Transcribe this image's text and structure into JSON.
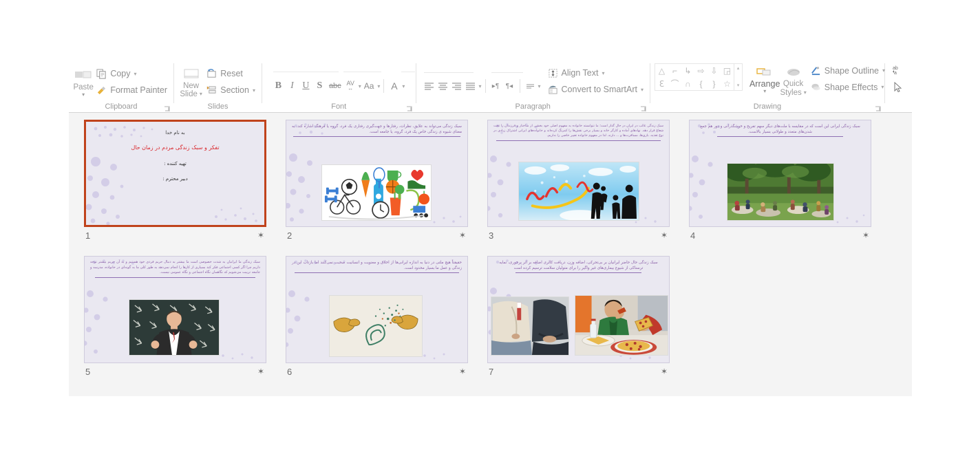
{
  "app": {
    "name": "PowerPoint Slide Sorter"
  },
  "ribbon": {
    "groups": [
      {
        "id": "clipboard",
        "label": "Clipboard",
        "paste_label": "Paste",
        "commands": [
          {
            "icon": "copy-icon",
            "label": "Copy",
            "has_arrow": true
          },
          {
            "icon": "format-painter-icon",
            "label": "Format Painter",
            "has_arrow": false
          }
        ]
      },
      {
        "id": "slides",
        "label": "Slides",
        "new_slide_label": "New\nSlide",
        "new_slide_line1": "New",
        "new_slide_line2": "Slide",
        "commands": [
          {
            "icon": "reset-icon",
            "label": "Reset",
            "has_arrow": false
          },
          {
            "icon": "section-icon",
            "label": "Section",
            "has_arrow": true
          }
        ]
      },
      {
        "id": "font",
        "label": "Font",
        "buttons": [
          {
            "icon": "bold-icon",
            "label": "B"
          },
          {
            "icon": "italic-icon",
            "label": "I"
          },
          {
            "icon": "underline-icon",
            "label": "U"
          },
          {
            "icon": "text-shadow-icon",
            "label": "S"
          },
          {
            "icon": "strikethrough-icon",
            "label": "abc"
          },
          {
            "icon": "character-spacing-icon",
            "label": "AV"
          },
          {
            "icon": "change-case-icon",
            "label": "Aa"
          },
          {
            "icon": "font-color-icon",
            "label": "A"
          }
        ]
      },
      {
        "id": "paragraph",
        "label": "Paragraph",
        "commands": [
          {
            "icon": "align-text-icon",
            "label": "Align Text",
            "has_arrow": true
          },
          {
            "icon": "convert-to-smartart-icon",
            "label": "Convert to SmartArt",
            "has_arrow": true
          }
        ]
      },
      {
        "id": "drawing",
        "label": "Drawing",
        "arrange_label": "Arrange",
        "quick_styles_line1": "Quick",
        "quick_styles_line2": "Styles",
        "commands": [
          {
            "icon": "shape-outline-icon",
            "label": "Shape Outline",
            "has_arrow": true
          },
          {
            "icon": "shape-effects-icon",
            "label": "Shape Effects",
            "has_arrow": true
          }
        ]
      },
      {
        "id": "editing",
        "label": "",
        "commands": [
          {
            "icon": "replace-icon",
            "label": ""
          },
          {
            "icon": "select-pointer-icon",
            "label": ""
          }
        ]
      }
    ]
  },
  "slides": [
    {
      "number": "1",
      "selected": true,
      "has_transition_star": true,
      "layout": "title",
      "lines": [
        "به نام خدا",
        "تفکر و سبک زندگی مردم در زمان حال",
        "تهیه کننده :",
        "دبیر محترم :"
      ],
      "title_color": "#d9262b"
    },
    {
      "number": "2",
      "selected": false,
      "has_transition_star": true,
      "layout": "text-image",
      "body": "سبک زندگی می‌تواند به علایق، نظرات، رفتارها و جهت‌گیری رفتاری یک فرد، گروه یا فرهنگ اشاره کند. به معنای شیوه ی زندگی خاص یک فرد، گروه، یا جامعه است.",
      "image_name": "healthy-lifestyle-illustration"
    },
    {
      "number": "3",
      "selected": false,
      "has_transition_star": true,
      "layout": "text-image",
      "body": "سبک زندگی غالب در ایران در حال گذار است؛ ما نتوانسته خانواده به مفهوم اصلی خود بخشی از ساختار و فرزندان را تحت شعاع قرار دهد. نهادهای آماده و کارگر خانه و بسیار برخی نقش‌ها را کمرنگ کرده‌اند و خانواده‌های ایرانی اشتراک زیادی در نوع تغذیه، بازی‌ها، مسافرت‌ها و ... دارند. لذا در مفهوم خانواده تغییر خاصی را نداریم.",
      "image_name": "sabk-zendegi-banner"
    },
    {
      "number": "4",
      "selected": false,
      "has_transition_star": true,
      "layout": "text-image",
      "body": "سبک زندگی ایرانی این است که در مقایسه با ملت‌های دیگر سهم تفریح و خوشگذرانی و دور هم جمع شدن‌های متعدد و طولانی بسیار بالاست.",
      "image_name": "park-picnic-photo"
    },
    {
      "number": "5",
      "selected": false,
      "has_transition_star": true,
      "layout": "text-image",
      "body": "سبک زندگی ما ایرانیان به شدت خصوصی است ما بیشتر به دنبال حریم فردی خود هستیم و به آن حریم بیشتر توجه داریم چرا اگر کسی اجتماعی فکر کند بسیاری از کارها را انجام نمی‌دهد به طور کلی ما به گونه‌ای در خانواده، مدرسه و جامعه تربیت می‌شویم که نگاهمان نگاه اجتماعی و نگاه عمومی نیست.",
      "image_name": "stressed-man-blackboard-photo"
    },
    {
      "number": "6",
      "selected": false,
      "has_transition_star": true,
      "layout": "text-image",
      "body": "حقیقتاً هیچ ملتی در دنیا به اندازه ایرانی‌ها از اخلاق و معنویت و انسانیت صحبت نمی‌کنند اما بازتاب این در زندگی و عمل ما بسیار محدود است.",
      "image_name": "hands-paisley-illustration"
    },
    {
      "number": "7",
      "selected": false,
      "has_transition_star": true,
      "layout": "text-two-images",
      "body": "سبک زندگی حال حاضر ایرانیان بر بی‌تحرکی، اضافه وزن، دریافت کالری اضافه بر اثر پرخوری، نمایه ترسناکی از شیوع بیماری‌های غیر واگیر را برای متولیان سلامت ترسیم کرده است",
      "image_name_left": "overweight-men-photo",
      "image_name_right": "boy-eating-pizza-photo"
    }
  ],
  "colors": {
    "selection_border": "#c0431c",
    "slide_background": "#eae8f1",
    "slide_text_purple": "#8a5fa8",
    "panel_background": "#f4f4f4",
    "ribbon_text": "#8f8f8f"
  }
}
